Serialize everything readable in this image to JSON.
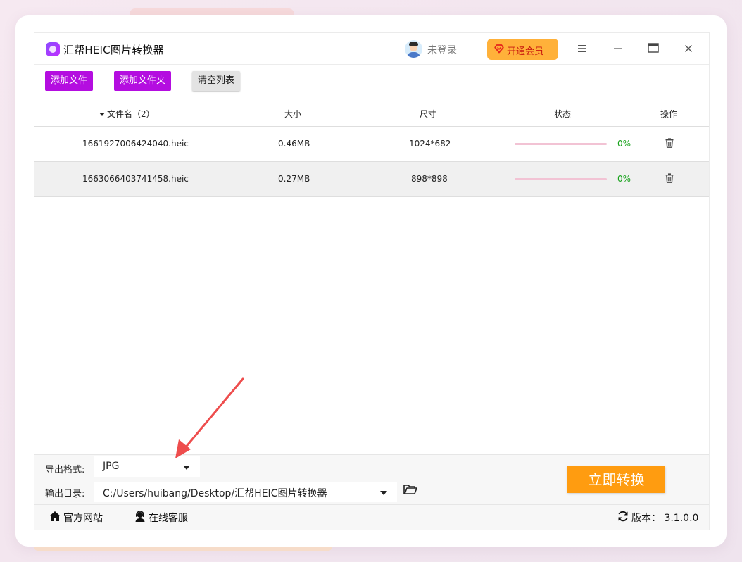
{
  "app": {
    "title": "汇帮HEIC图片转换器"
  },
  "header": {
    "login_label": "未登录",
    "vip_label": "开通会员",
    "vip_icon": "diamond-heart-icon",
    "controls": [
      "menu-icon",
      "minimize-icon",
      "maximize-icon",
      "close-icon"
    ]
  },
  "toolbar": {
    "add_file": "添加文件",
    "add_folder": "添加文件夹",
    "clear_list": "清空列表"
  },
  "table": {
    "columns": {
      "name": "文件名（2）",
      "size": "大小",
      "dimensions": "尺寸",
      "status": "状态",
      "actions": "操作"
    },
    "rows": [
      {
        "name": "1661927006424040.heic",
        "size": "0.46MB",
        "dimensions": "1024*682",
        "progress": "0%"
      },
      {
        "name": "1663066403741458.heic",
        "size": "0.27MB",
        "dimensions": "898*898",
        "progress": "0%"
      }
    ]
  },
  "bottom": {
    "format_label": "导出格式:",
    "format_value": "JPG",
    "output_label": "输出目录:",
    "output_value": "C:/Users/huibang/Desktop/汇帮HEIC图片转换器",
    "convert_label": "立即转换"
  },
  "footer": {
    "website": "官方网站",
    "support": "在线客服",
    "version": "版本： 3.1.0.0"
  },
  "colors": {
    "purple_button": "#b40de0",
    "vip_bg": "#ffb13a",
    "convert_bg": "#ff9c10",
    "progress_text": "#17a21b",
    "annotation_arrow": "#ee4d4d"
  }
}
